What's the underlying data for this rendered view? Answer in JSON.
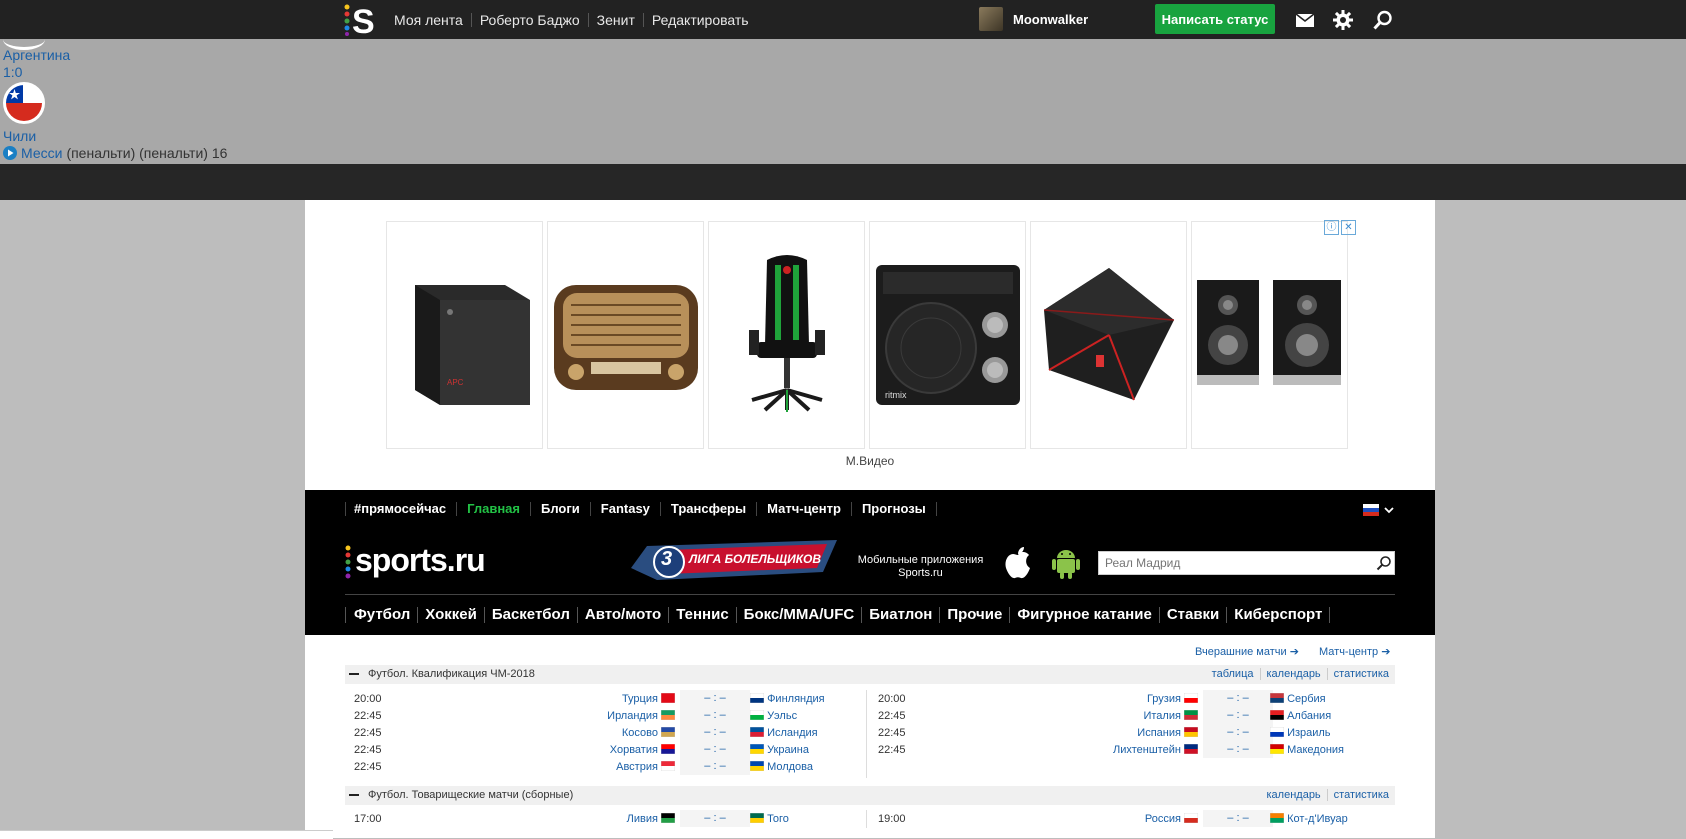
{
  "topbar": {
    "nav": [
      "Моя лента",
      "Роберто Баджо",
      "Зенит",
      "Редактировать"
    ],
    "username": "Moonwalker",
    "status_button": "Написать статус"
  },
  "score_widget": {
    "team1": "Аргентина",
    "score": "1:0",
    "team2": "Чили",
    "scorer": "Месси",
    "scorer_note": "(пенальти) (пенальти) 16"
  },
  "ad": {
    "items": [
      "apc-ups",
      "retro-radio",
      "gaming-chair",
      "ritmix-radio",
      "hp-omen-pc",
      "sven-speakers"
    ],
    "source": "М.Видео",
    "info_glyph": "ⓘ",
    "close_glyph": "✕"
  },
  "header": {
    "top_nav": [
      "#прямосейчас",
      "Главная",
      "Блоги",
      "Fantasy",
      "Трансферы",
      "Матч-центр",
      "Прогнозы"
    ],
    "active_top_nav": "Главная",
    "logo": "sports.ru",
    "liga_number": "3",
    "liga_text": "ЛИГА БОЛЕЛЬЩИКОВ",
    "mobile_apps_line1": "Мобильные приложения",
    "mobile_apps_line2": "Sports.ru",
    "search_placeholder": "Реал Мадрид",
    "sports_nav": [
      "Футбол",
      "Хоккей",
      "Баскетбол",
      "Авто/мото",
      "Теннис",
      "Бокс/ММА/UFC",
      "Биатлон",
      "Прочие",
      "Фигурное катание",
      "Ставки",
      "Киберспорт"
    ]
  },
  "matches": {
    "yesterday_link": "Вчерашние матчи",
    "matchcenter_link": "Матч-центр",
    "sections": [
      {
        "name": "Футбол. Квалификация ЧМ-2018",
        "actions": [
          "таблица",
          "календарь",
          "статистика"
        ],
        "left": [
          {
            "time": "20:00",
            "home": "Турция",
            "score": "– : –",
            "away": "Финляндия"
          },
          {
            "time": "22:45",
            "home": "Ирландия",
            "score": "– : –",
            "away": "Уэльс"
          },
          {
            "time": "22:45",
            "home": "Косово",
            "score": "– : –",
            "away": "Исландия"
          },
          {
            "time": "22:45",
            "home": "Хорватия",
            "score": "– : –",
            "away": "Украина"
          },
          {
            "time": "22:45",
            "home": "Австрия",
            "score": "– : –",
            "away": "Молдова"
          }
        ],
        "right": [
          {
            "time": "20:00",
            "home": "Грузия",
            "score": "– : –",
            "away": "Сербия"
          },
          {
            "time": "22:45",
            "home": "Италия",
            "score": "– : –",
            "away": "Албания"
          },
          {
            "time": "22:45",
            "home": "Испания",
            "score": "– : –",
            "away": "Израиль"
          },
          {
            "time": "22:45",
            "home": "Лихтенштейн",
            "score": "– : –",
            "away": "Македония"
          }
        ]
      },
      {
        "name": "Футбол. Товарищеские матчи (сборные)",
        "actions": [
          "календарь",
          "статистика"
        ],
        "left": [
          {
            "time": "17:00",
            "home": "Ливия",
            "score": "– : –",
            "away": "Того"
          }
        ],
        "right": [
          {
            "time": "19:00",
            "home": "Россия",
            "score": "– : –",
            "away": "Кот-д'Ивуар"
          }
        ]
      }
    ]
  },
  "colors": {
    "accent_green": "#18a33f",
    "link_blue": "#1a5fa6",
    "header_black": "#000000"
  }
}
